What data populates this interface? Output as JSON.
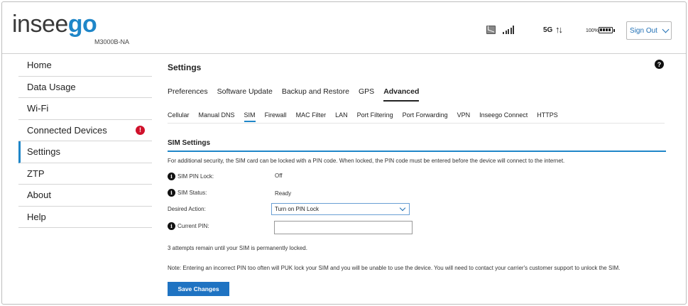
{
  "brand": {
    "logo_prefix": "insee",
    "logo_suffix": "go",
    "model": "M3000B-NA",
    "accent_color": "#1f86c8"
  },
  "status": {
    "network": "5G",
    "arrows": "↑↓",
    "battery": "100%",
    "icons": [
      "message-icon",
      "signal-bars-icon",
      "battery-icon"
    ]
  },
  "header": {
    "signout_label": "Sign Out"
  },
  "sidebar": {
    "items": [
      {
        "label": "Home"
      },
      {
        "label": "Data Usage"
      },
      {
        "label": "Wi-Fi"
      },
      {
        "label": "Connected Devices",
        "badge": "!"
      },
      {
        "label": "Settings",
        "active": true
      },
      {
        "label": "ZTP"
      },
      {
        "label": "About"
      },
      {
        "label": "Help"
      }
    ]
  },
  "main": {
    "title": "Settings",
    "help": "?",
    "tabs": [
      "Preferences",
      "Software Update",
      "Backup and Restore",
      "GPS",
      "Advanced"
    ],
    "active_tab": "Advanced",
    "subtabs": [
      "Cellular",
      "Manual DNS",
      "SIM",
      "Firewall",
      "MAC Filter",
      "LAN",
      "Port Filtering",
      "Port Forwarding",
      "VPN",
      "Inseego Connect",
      "HTTPS"
    ],
    "active_subtab": "SIM",
    "section_title": "SIM Settings",
    "description": "For additional security, the SIM card can be locked with a PIN code. When locked, the PIN code must be entered before the device will connect to the internet.",
    "fields": {
      "pin_lock_label": "SIM PIN Lock:",
      "pin_lock_value": "Off",
      "sim_status_label": "SIM Status:",
      "sim_status_value": "Ready",
      "desired_action_label": "Desired Action:",
      "desired_action_value": "Turn on PIN Lock",
      "current_pin_label": "Current PIN:",
      "current_pin_value": ""
    },
    "attempts_note": "3 attempts remain until your SIM is permanently locked.",
    "warning_note": "Note: Entering an incorrect PIN too often will PUK lock your SIM and you will be unable to use the device. You will need to contact your carrier's customer support to unlock the SIM.",
    "save_label": "Save Changes"
  }
}
